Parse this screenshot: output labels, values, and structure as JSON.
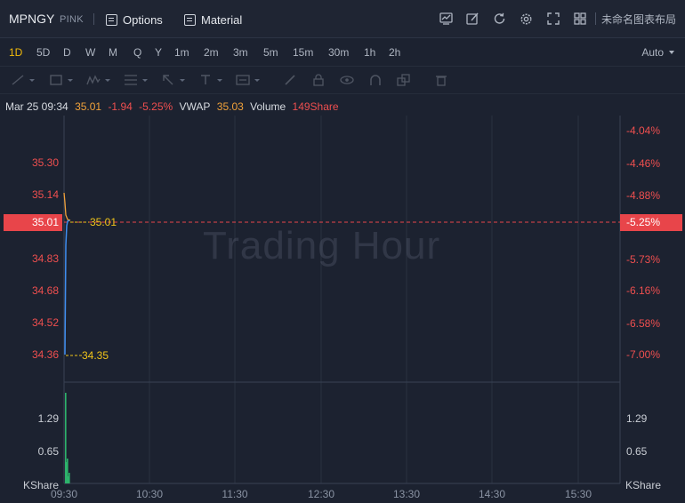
{
  "header": {
    "symbol": "MPNGY",
    "exchange": "PINK",
    "options_label": "Options",
    "material_label": "Material",
    "layout_name": "未命名图表布局",
    "tools": [
      "chart-icon",
      "edit-icon",
      "refresh-icon",
      "settings-icon",
      "fullscreen-icon",
      "grid-icon"
    ]
  },
  "periods": {
    "items": [
      "1D",
      "5D",
      "D",
      "W",
      "M",
      "Q",
      "Y",
      "1m",
      "2m",
      "3m",
      "5m",
      "15m",
      "30m",
      "1h",
      "2h"
    ],
    "active": "1D",
    "scale_mode": "Auto"
  },
  "info": {
    "datetime": "Mar 25 09:34",
    "price": "35.01",
    "change": "-1.94",
    "change_pct": "-5.25%",
    "vwap_label": "VWAP",
    "vwap": "35.03",
    "volume_label": "Volume",
    "volume": "149Share"
  },
  "chart": {
    "watermark": "Trading Hour",
    "price_ticks_left": [
      "35.30",
      "35.14",
      "34.83",
      "34.68",
      "34.52",
      "34.36"
    ],
    "pct_ticks_right": [
      "-4.04%",
      "-4.46%",
      "-4.88%",
      "-5.73%",
      "-6.16%",
      "-6.58%",
      "-7.00%"
    ],
    "current_price_tag": "35.01",
    "current_pct_tag": "-5.25%",
    "high_label": "35.01",
    "low_label": "34.35",
    "volume_ticks_left": [
      "1.29",
      "0.65"
    ],
    "volume_ticks_right": [
      "1.29",
      "0.65"
    ],
    "volume_unit": "KShare",
    "time_ticks": [
      "09:30",
      "10:30",
      "11:30",
      "12:30",
      "13:30",
      "14:30",
      "15:30"
    ],
    "colors": {
      "up": "#ef4f4f",
      "price_line": "#3f8ef0",
      "vwap_line": "#f0a13a",
      "volume_bar": "#2db36b",
      "grid": "#2a3140"
    }
  }
}
